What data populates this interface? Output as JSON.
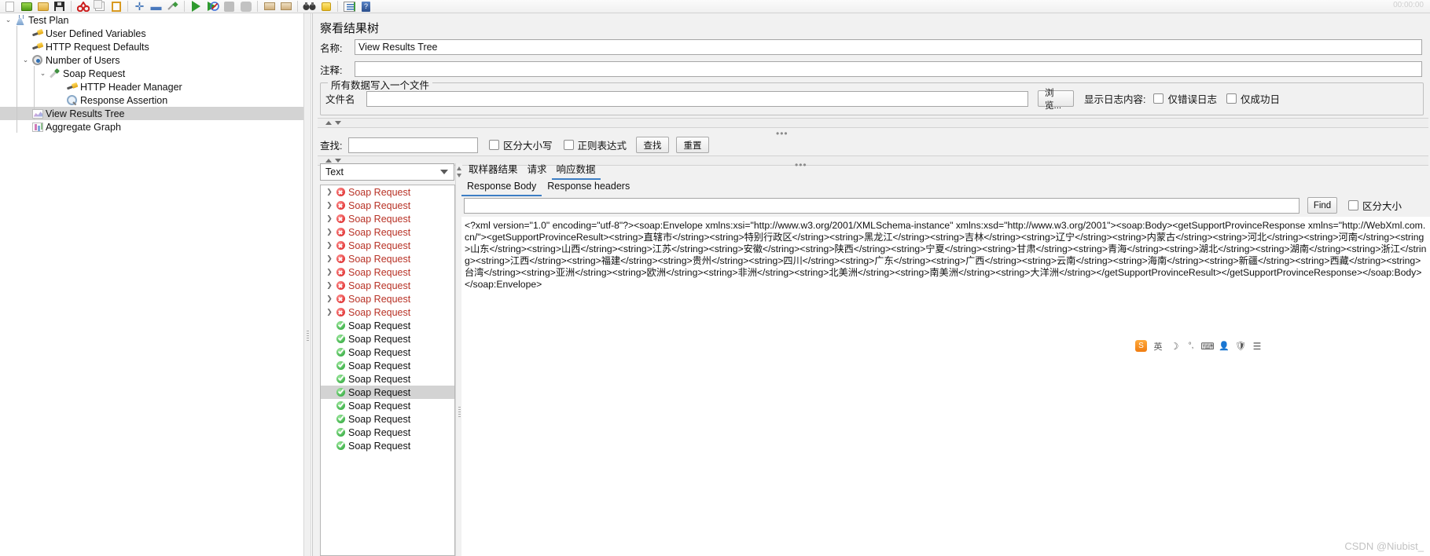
{
  "toolbar": {
    "clock": "00:00:00",
    "buttons": [
      {
        "name": "new",
        "icon": "new-file-icon"
      },
      {
        "name": "templates",
        "icon": "open-template-icon"
      },
      {
        "name": "open",
        "icon": "folder-open-icon"
      },
      {
        "name": "save",
        "icon": "save-icon"
      },
      {
        "name": "cut",
        "icon": "cut-icon"
      },
      {
        "name": "copy",
        "icon": "copy-icon"
      },
      {
        "name": "paste",
        "icon": "paste-icon"
      },
      {
        "name": "expand-all",
        "icon": "plus-icon"
      },
      {
        "name": "collapse-all",
        "icon": "minus-icon"
      },
      {
        "name": "toggle",
        "icon": "toggle-icon"
      },
      {
        "name": "start",
        "icon": "play-icon"
      },
      {
        "name": "start-no-pauses",
        "icon": "play-no-pauses-icon"
      },
      {
        "name": "stop",
        "icon": "stop-icon"
      },
      {
        "name": "shutdown",
        "icon": "shutdown-icon"
      },
      {
        "name": "clear",
        "icon": "clear-icon"
      },
      {
        "name": "clear-all",
        "icon": "clear-all-icon"
      },
      {
        "name": "search",
        "icon": "binoculars-icon"
      },
      {
        "name": "reset-search",
        "icon": "brush-icon"
      },
      {
        "name": "function-helper",
        "icon": "function-list-icon"
      },
      {
        "name": "help",
        "icon": "help-icon"
      }
    ]
  },
  "tree": {
    "nodes": [
      {
        "label": "Test Plan",
        "depth": 0,
        "icon": "test-plan-icon",
        "twisty": "v",
        "selected": false
      },
      {
        "label": "User Defined Variables",
        "depth": 1,
        "icon": "wrench-icon",
        "twisty": "",
        "selected": false
      },
      {
        "label": "HTTP Request Defaults",
        "depth": 1,
        "icon": "wrench-icon",
        "twisty": "",
        "selected": false
      },
      {
        "label": "Number of Users",
        "depth": 1,
        "icon": "thread-group-icon",
        "twisty": "v",
        "selected": false
      },
      {
        "label": "Soap Request",
        "depth": 2,
        "icon": "sampler-icon",
        "twisty": "v",
        "selected": false
      },
      {
        "label": "HTTP Header Manager",
        "depth": 3,
        "icon": "wrench-icon",
        "twisty": "",
        "selected": false
      },
      {
        "label": "Response Assertion",
        "depth": 3,
        "icon": "assertion-icon",
        "twisty": "",
        "selected": false
      },
      {
        "label": "View Results Tree",
        "depth": 1,
        "icon": "view-results-tree-icon",
        "twisty": "",
        "selected": true
      },
      {
        "label": "Aggregate Graph",
        "depth": 1,
        "icon": "aggregate-graph-icon",
        "twisty": "",
        "selected": false
      }
    ]
  },
  "main": {
    "title": "察看结果树",
    "name_label": "名称:",
    "name_value": "View Results Tree",
    "comment_label": "注释:",
    "comment_value": "",
    "group_title": "所有数据写入一个文件",
    "filename_label": "文件名",
    "filename_value": "",
    "browse_button": "浏览...",
    "log_display_label": "显示日志内容:",
    "errors_only_label": "仅错误日志",
    "success_only_label": "仅成功日",
    "search_label": "查找:",
    "search_value": "",
    "case_sensitive_label": "区分大小写",
    "regex_label": "正则表达式",
    "find_button": "查找",
    "reset_button": "重置",
    "render_combo_value": "Text",
    "dots": "•••"
  },
  "results": {
    "rows": [
      {
        "label": "Soap Request",
        "status": "error",
        "expandable": true,
        "selected": false
      },
      {
        "label": "Soap Request",
        "status": "error",
        "expandable": true,
        "selected": false
      },
      {
        "label": "Soap Request",
        "status": "error",
        "expandable": true,
        "selected": false
      },
      {
        "label": "Soap Request",
        "status": "error",
        "expandable": true,
        "selected": false
      },
      {
        "label": "Soap Request",
        "status": "error",
        "expandable": true,
        "selected": false
      },
      {
        "label": "Soap Request",
        "status": "error",
        "expandable": true,
        "selected": false
      },
      {
        "label": "Soap Request",
        "status": "error",
        "expandable": true,
        "selected": false
      },
      {
        "label": "Soap Request",
        "status": "error",
        "expandable": true,
        "selected": false
      },
      {
        "label": "Soap Request",
        "status": "error",
        "expandable": true,
        "selected": false
      },
      {
        "label": "Soap Request",
        "status": "error",
        "expandable": true,
        "selected": false
      },
      {
        "label": "Soap Request",
        "status": "success",
        "expandable": false,
        "selected": false
      },
      {
        "label": "Soap Request",
        "status": "success",
        "expandable": false,
        "selected": false
      },
      {
        "label": "Soap Request",
        "status": "success",
        "expandable": false,
        "selected": false
      },
      {
        "label": "Soap Request",
        "status": "success",
        "expandable": false,
        "selected": false
      },
      {
        "label": "Soap Request",
        "status": "success",
        "expandable": false,
        "selected": false
      },
      {
        "label": "Soap Request",
        "status": "success",
        "expandable": false,
        "selected": true
      },
      {
        "label": "Soap Request",
        "status": "success",
        "expandable": false,
        "selected": false
      },
      {
        "label": "Soap Request",
        "status": "success",
        "expandable": false,
        "selected": false
      },
      {
        "label": "Soap Request",
        "status": "success",
        "expandable": false,
        "selected": false
      },
      {
        "label": "Soap Request",
        "status": "success",
        "expandable": false,
        "selected": false
      }
    ]
  },
  "detail": {
    "tabs": [
      {
        "label": "取样器结果",
        "active": false
      },
      {
        "label": "请求",
        "active": false
      },
      {
        "label": "响应数据",
        "active": true
      }
    ],
    "subtabs": [
      {
        "label": "Response Body",
        "active": true
      },
      {
        "label": "Response headers",
        "active": false
      }
    ],
    "search_value": "",
    "find_button": "Find",
    "case_sensitive_label": "区分大小",
    "response_text": "<?xml version=\"1.0\" encoding=\"utf-8\"?><soap:Envelope xmlns:xsi=\"http://www.w3.org/2001/XMLSchema-instance\" xmlns:xsd=\"http://www.w3.org/2001\"><soap:Body><getSupportProvinceResponse xmlns=\"http://WebXml.com.cn/\"><getSupportProvinceResult><string>直辖市</string><string>特别行政区</string><string>黑龙江</string><string>吉林</string><string>辽宁</string><string>内蒙古</string><string>河北</string><string>河南</string><string>山东</string><string>山西</string><string>江苏</string><string>安徽</string><string>陕西</string><string>宁夏</string><string>甘肃</string><string>青海</string><string>湖北</string><string>湖南</string><string>浙江</string><string>江西</string><string>福建</string><string>贵州</string><string>四川</string><string>广东</string><string>广西</string><string>云南</string><string>海南</string><string>新疆</string><string>西藏</string><string>台湾</string><string>亚洲</string><string>欧洲</string><string>非洲</string><string>北美洲</string><string>南美洲</string><string>大洋洲</string></getSupportProvinceResult></getSupportProvinceResponse></soap:Body></soap:Envelope>"
  },
  "mini_toolbar": {
    "icons": [
      {
        "name": "sogou-input-icon",
        "glyph": "S"
      },
      {
        "name": "chinese-mode-icon",
        "glyph": "英"
      },
      {
        "name": "moon-icon",
        "glyph": "☽"
      },
      {
        "name": "half-width-icon",
        "glyph": "°,"
      },
      {
        "name": "keyboard-icon",
        "glyph": "⌨"
      },
      {
        "name": "user-icon",
        "glyph": "👤"
      },
      {
        "name": "toolbox-icon",
        "glyph": "🛡"
      },
      {
        "name": "menu-icon",
        "glyph": "☰"
      }
    ]
  },
  "watermark": "CSDN @Niubist_"
}
